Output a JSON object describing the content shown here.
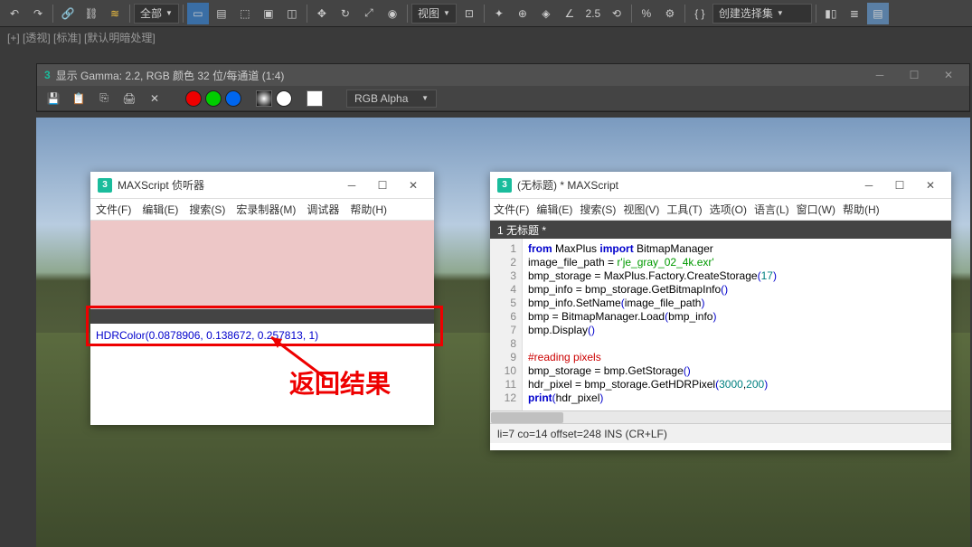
{
  "toolbar": {
    "dropdown1_label": "全部",
    "dropdown2_label": "视图",
    "dropdown3_label": "创建选择集",
    "num_label": "2.5"
  },
  "breadcrumb": {
    "text": "[+] [透视] [标准] [默认明暗处理]"
  },
  "gamma_window": {
    "title": "显示 Gamma: 2.2, RGB 颜色 32 位/每通道 (1:4)",
    "rgb_dropdown": "RGB Alpha"
  },
  "listener_window": {
    "title": "MAXScript 侦听器",
    "menus": [
      "文件(F)",
      "编辑(E)",
      "搜索(S)",
      "宏录制器(M)",
      "调试器",
      "帮助(H)"
    ],
    "output_line": "HDRColor(0.0878906, 0.138672, 0.257813, 1)",
    "annotation": "返回结果"
  },
  "editor_window": {
    "title": "(无标题) * MAXScript",
    "menus": [
      "文件(F)",
      "编辑(E)",
      "搜索(S)",
      "视图(V)",
      "工具(T)",
      "选项(O)",
      "语言(L)",
      "窗口(W)",
      "帮助(H)"
    ],
    "tab_label": "1 无标题 *",
    "code_lines": [
      {
        "n": 1,
        "raw": "from MaxPlus import BitmapManager"
      },
      {
        "n": 2,
        "raw": "image_file_path = r'je_gray_02_4k.exr'"
      },
      {
        "n": 3,
        "raw": "bmp_storage = MaxPlus.Factory.CreateStorage(17)"
      },
      {
        "n": 4,
        "raw": "bmp_info = bmp_storage.GetBitmapInfo()"
      },
      {
        "n": 5,
        "raw": "bmp_info.SetName(image_file_path)"
      },
      {
        "n": 6,
        "raw": "bmp = BitmapManager.Load(bmp_info)"
      },
      {
        "n": 7,
        "raw": "bmp.Display()"
      },
      {
        "n": 8,
        "raw": ""
      },
      {
        "n": 9,
        "raw": "#reading pixels"
      },
      {
        "n": 10,
        "raw": "bmp_storage = bmp.GetStorage()"
      },
      {
        "n": 11,
        "raw": "hdr_pixel = bmp_storage.GetHDRPixel(3000,200)"
      },
      {
        "n": 12,
        "raw": "print(hdr_pixel)"
      }
    ],
    "status": "li=7 co=14 offset=248 INS (CR+LF)"
  }
}
